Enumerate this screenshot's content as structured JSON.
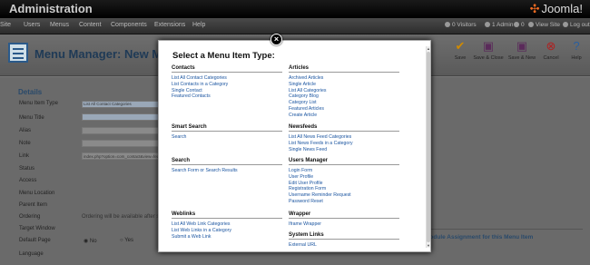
{
  "topbar": {
    "title": "Administration",
    "logo_text": "Joomla!"
  },
  "menubar": {
    "items": [
      "Site",
      "Users",
      "Menus",
      "Content",
      "Components",
      "Extensions",
      "Help"
    ],
    "status": {
      "visitors": "0 Visitors",
      "admins": "1 Admin",
      "messages": "0",
      "view_site": "View Site",
      "logout": "Log out"
    }
  },
  "toolbar": {
    "title": "Menu Manager: New Menu Item",
    "buttons": [
      {
        "label": "Save",
        "icon": "save-icon"
      },
      {
        "label": "Save & Close",
        "icon": "save-close-icon"
      },
      {
        "label": "Save & New",
        "icon": "save-new-icon"
      },
      {
        "label": "Cancel",
        "icon": "cancel-icon"
      },
      {
        "label": "Help",
        "icon": "help-icon"
      }
    ]
  },
  "form": {
    "section": "Details",
    "labels": [
      "Menu Item Type",
      "Menu Title",
      "Alias",
      "Note",
      "Link",
      "Status",
      "Access",
      "Menu Location",
      "Parent Item",
      "Ordering",
      "Target Window",
      "Default Page",
      "Language"
    ],
    "menu_item_type_value": "List All Contact Categories",
    "link_value": "index.php?option=com_contact&view=featured",
    "ordering_note": "Ordering will be available after saving",
    "default_page": {
      "yes": "Yes",
      "no": "No"
    },
    "right_panel_title": "Module Assignment for this Menu Item"
  },
  "modal": {
    "heading": "Select a Menu Item Type:",
    "left_groups": [
      {
        "title": "Contacts",
        "links": [
          "List All Contact Categories",
          "List Contacts in a Category",
          "Single Contact",
          "Featured Contacts"
        ]
      },
      {
        "title": "Smart Search",
        "links": [
          "Search"
        ]
      },
      {
        "title": "Search",
        "links": [
          "Search Form or Search Results"
        ]
      },
      {
        "title": "Weblinks",
        "links": [
          "List All Web Link Categories",
          "List Web Links in a Category",
          "Submit a Web Link"
        ]
      }
    ],
    "right_groups": [
      {
        "title": "Articles",
        "links": [
          "Archived Articles",
          "Single Article",
          "List All Categories",
          "Category Blog",
          "Category List",
          "Featured Articles",
          "Create Article"
        ]
      },
      {
        "title": "Newsfeeds",
        "links": [
          "List All News Feed Categories",
          "List News Feeds in a Category",
          "Single News Feed"
        ]
      },
      {
        "title": "Users Manager",
        "links": [
          "Login Form",
          "User Profile",
          "Edit User Profile",
          "Registration Form",
          "Username Reminder Request",
          "Password Reset"
        ]
      },
      {
        "title": "Wrapper",
        "links": [
          "Iframe Wrapper"
        ]
      },
      {
        "title": "System Links",
        "links": [
          "External URL"
        ]
      }
    ]
  }
}
